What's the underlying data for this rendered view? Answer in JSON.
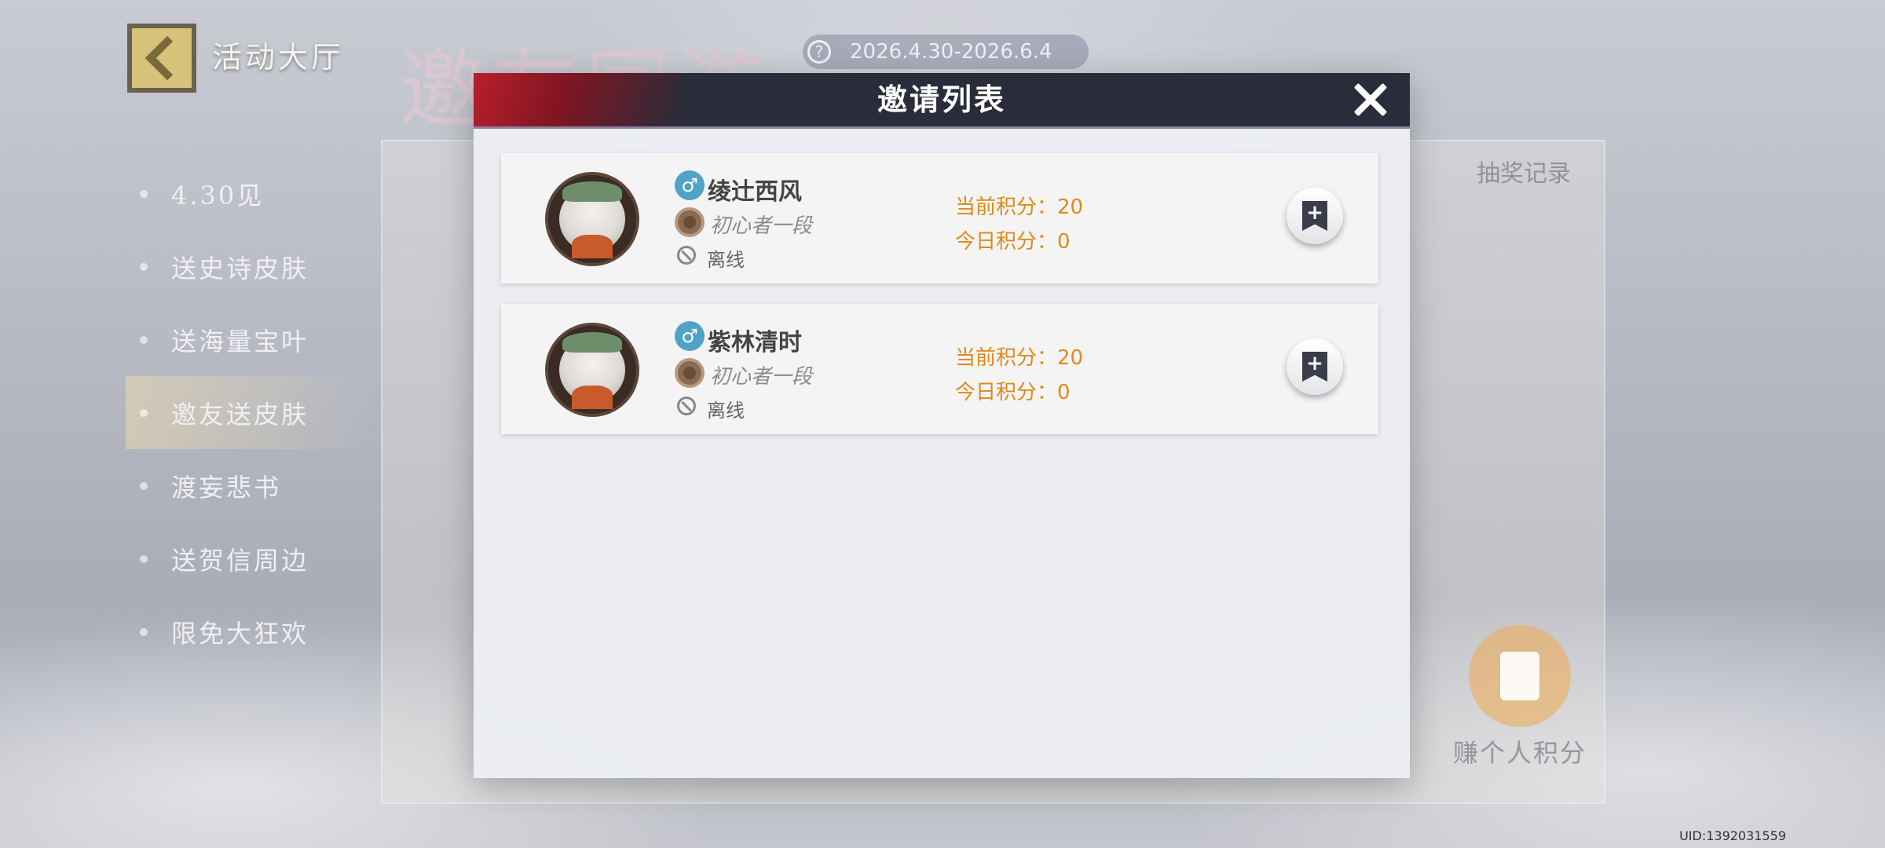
{
  "background": {
    "back_title": "活动大厅",
    "big_title": "邀友同游",
    "date_range": "2026.4.30-2026.6.4",
    "help_icon": "?",
    "menu": [
      {
        "label": "4.30见"
      },
      {
        "label": "送史诗皮肤"
      },
      {
        "label": "送海量宝叶"
      },
      {
        "label": "邀友送皮肤"
      },
      {
        "label": "渡妄悲书"
      },
      {
        "label": "送贺信周边"
      },
      {
        "label": "限免大狂欢"
      }
    ],
    "lottery_record": "抽奖记录",
    "earn_points": "赚个人积分",
    "uid": "UID:1392031559"
  },
  "modal": {
    "title": "邀请列表",
    "friends": [
      {
        "gender_icon": "♂",
        "name": "绫辻西风",
        "rank": "初心者一段",
        "status": "离线",
        "current_score": "当前积分：20",
        "today_score": "今日积分：0",
        "add_icon": "+"
      },
      {
        "gender_icon": "♂",
        "name": "紫林清时",
        "rank": "初心者一段",
        "status": "离线",
        "current_score": "当前积分：20",
        "today_score": "今日积分：0",
        "add_icon": "+"
      }
    ]
  },
  "colors": {
    "header_bg": "#2b2c3a",
    "accent_red": "#b91f2c",
    "score_orange": "#e08a18",
    "gender_blue": "#4fa3c6"
  }
}
